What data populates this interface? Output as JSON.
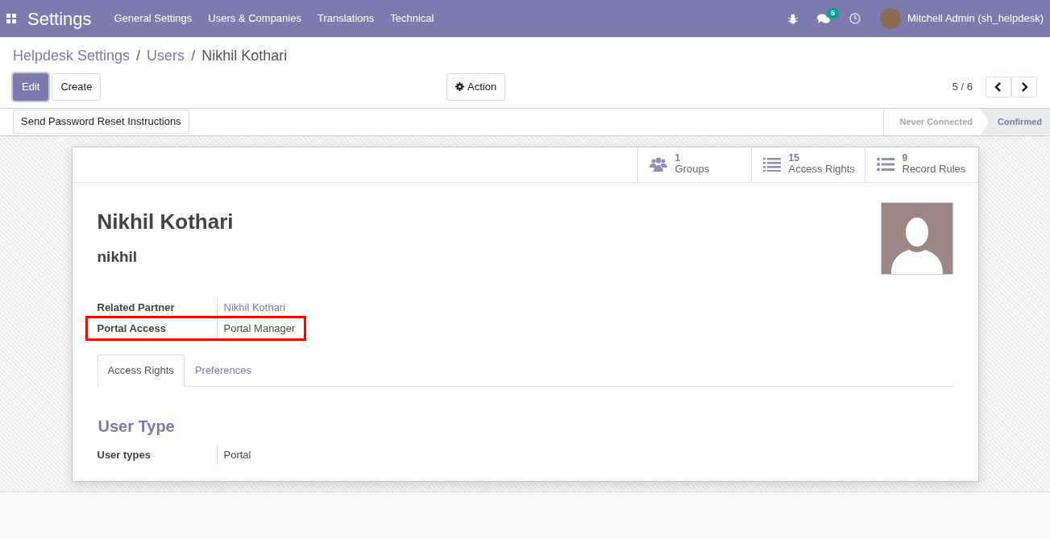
{
  "navbar": {
    "app_title": "Settings",
    "menu": [
      "General Settings",
      "Users & Companies",
      "Translations",
      "Technical"
    ],
    "messages_badge": "5",
    "user": "Mitchell Admin (sh_helpdesk)"
  },
  "breadcrumb": [
    {
      "label": "Helpdesk Settings",
      "kind": "link"
    },
    {
      "label": "/",
      "kind": "separator"
    },
    {
      "label": "Users",
      "kind": "link"
    },
    {
      "label": "/",
      "kind": "separator"
    },
    {
      "label": "Nikhil Kothari",
      "kind": "current"
    }
  ],
  "buttons": {
    "edit": "Edit",
    "create": "Create",
    "action": "Action"
  },
  "pager": "5 / 6",
  "header_button": "Send Password Reset Instructions",
  "statusbar": [
    {
      "label": "Never Connected",
      "selected": false
    },
    {
      "label": "Confirmed",
      "selected": true
    }
  ],
  "smart_buttons": [
    {
      "count": "1",
      "label": "Groups",
      "kind": "groups"
    },
    {
      "count": "15",
      "label": "Access Rights",
      "kind": "list"
    },
    {
      "count": "9",
      "label": "Record Rules",
      "kind": "bullets"
    }
  ],
  "name": "Nikhil Kothari",
  "login": "nikhil",
  "fields": [
    {
      "label": "Related Partner",
      "value": "Nikhil Kothari",
      "kind": "link"
    },
    {
      "label": "Portal Access",
      "value": "Portal Manager",
      "kind": "text",
      "highlighted": true
    }
  ],
  "tabs": [
    {
      "label": "Access Rights",
      "selected": true
    },
    {
      "label": "Preferences",
      "selected": false
    }
  ],
  "section_title": "User Type",
  "section_fields": [
    {
      "label": "User types",
      "value": "Portal"
    }
  ]
}
